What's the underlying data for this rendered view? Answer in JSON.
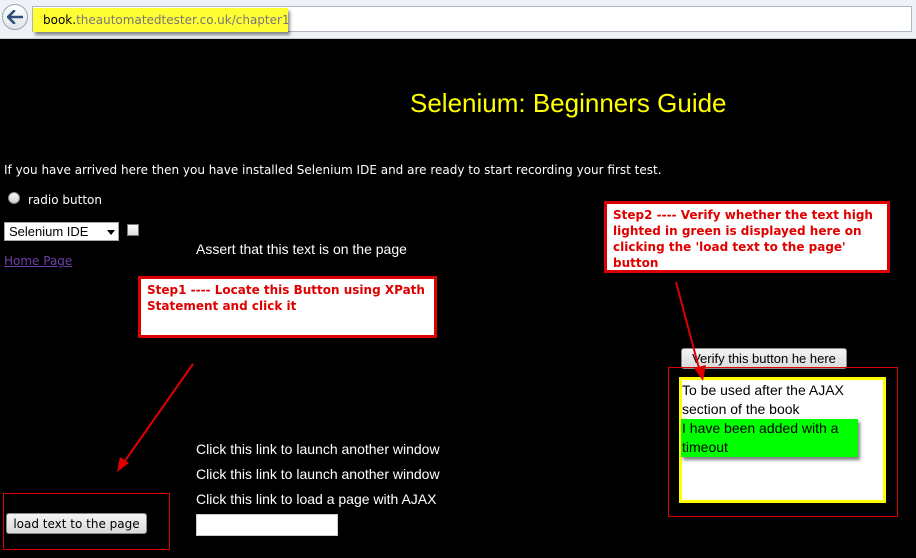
{
  "browser": {
    "url_prefix": "book.",
    "url_host": "theautomatedtester.co.uk",
    "url_path": "/chapter1",
    "highlight_color": "#ffff33"
  },
  "page": {
    "title": "Selenium: Beginners Guide",
    "intro": "If you have arrived here then you have installed Selenium IDE and are ready to start recording your first test.",
    "radio_label": "radio button",
    "select_value": "Selenium IDE",
    "assert_text": "Assert that this text is on the page",
    "home_link": "Home Page",
    "verify_button": "Verify this button he here",
    "ajax_text": "To be used after the AJAX section of the book",
    "ajax_added": "I have been added with a timeout",
    "link1": "Click this link to launch another window",
    "link2": "Click this link to launch another window",
    "link3": "Click this link to load a page with AJAX",
    "load_button": "load text to the page"
  },
  "annotations": {
    "step1": "Step1 ---- Locate this Button using XPath Statement and click it",
    "step2": "Step2 ---- Verify whether the text high lighted in green is displayed here on clicking the 'load text to the page' button"
  },
  "colors": {
    "title": "#ffff00",
    "annotation": "#e00000",
    "ajax_added_bg": "#00ff00",
    "background": "#000000"
  }
}
